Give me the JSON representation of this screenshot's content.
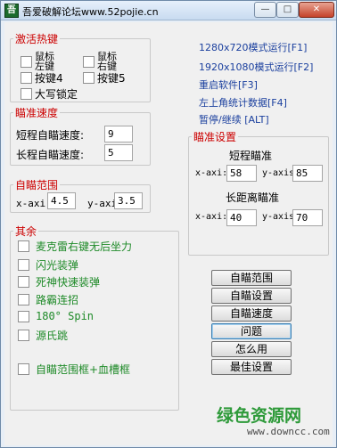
{
  "window": {
    "title": "吾爱破解论坛www.52pojie.cn",
    "icon_glyph": "吾",
    "min_glyph": "—",
    "max_glyph": "□",
    "close_glyph": "✕"
  },
  "hotkeys": {
    "title": "激活热键",
    "left_mouse": "鼠标左键",
    "right_mouse": "鼠标右键",
    "key4": "按键4",
    "key5": "按键5",
    "caps": "大写锁定"
  },
  "aim_speed": {
    "title": "瞄准速度",
    "short_label": "短程自瞄速度:",
    "short_value": "9",
    "long_label": "长程自瞄速度:",
    "long_value": "5"
  },
  "aim_range": {
    "title": "自瞄范围",
    "x_label": "x-axi",
    "x_value": "4.5",
    "y_label": "y-axi",
    "y_value": "3.5"
  },
  "misc": {
    "title": "其余",
    "items": [
      "麦克雷右键无后坐力",
      "闪光装弹",
      "死神快速装弹",
      "路霸连招",
      "180° Spin",
      "源氏跳",
      "自瞄范围框+血槽框"
    ]
  },
  "links": {
    "run720": "1280x720模式运行[F1]",
    "run1080": "1920x1080模式运行[F2]",
    "restart": "重启软件[F3]",
    "stats": "左上角统计数据[F4]",
    "pause": "暂停/继续 [ALT]"
  },
  "aim_settings": {
    "title": "瞄准设置",
    "short_title": "短程瞄准",
    "short_x_label": "x-axi:",
    "short_x_value": "58",
    "short_y_label": "y-axis",
    "short_y_value": "85",
    "long_title": "长距离瞄准",
    "long_x_label": "x-axi:",
    "long_x_value": "40",
    "long_y_label": "y-axis",
    "long_y_value": "70"
  },
  "buttons": {
    "range": "自瞄范围",
    "settings": "自瞄设置",
    "speed": "自瞄速度",
    "help": "问题",
    "howto": "怎么用",
    "best": "最佳设置"
  },
  "watermark": {
    "text": "绿色资源网",
    "url": "www.downcc.com"
  },
  "colors": {
    "group_title": "#cc0000",
    "link": "#1a3f9e",
    "misc_label": "#1e8a28"
  }
}
